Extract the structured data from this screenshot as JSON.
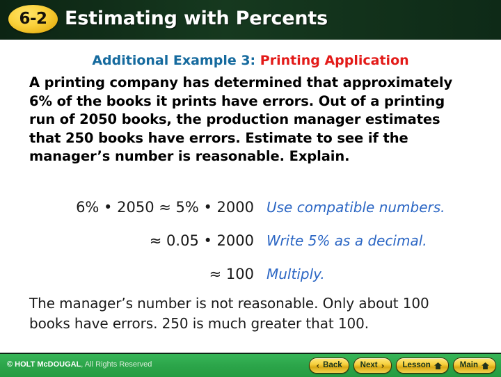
{
  "header": {
    "lesson_badge": "6-2",
    "title": "Estimating with Percents",
    "background_color": "#11321c",
    "badge_color": "#fbd23c"
  },
  "slide": {
    "example_heading": {
      "primary": "Additional Example 3:",
      "primary_color": "#156a9e",
      "secondary": "Printing Application",
      "secondary_color": "#e31a18"
    },
    "problem_text": "A printing company has determined that approximately 6% of the books it prints have errors. Out of a printing run of 2050 books, the production manager estimates that 250 books have errors. Estimate to see if the manager’s number is reasonable. Explain.",
    "steps": [
      {
        "math": "6% • 2050 ≈ 5% • 2000",
        "note": "Use compatible numbers."
      },
      {
        "math": "≈ 0.05 • 2000",
        "note": "Write 5% as a decimal."
      },
      {
        "math": "≈ 100",
        "note": "Multiply."
      }
    ],
    "note_color": "#2b66c4",
    "conclusion": "The manager’s number is not reasonable. Only about 100 books have errors. 250 is much greater that 100."
  },
  "footer": {
    "copyright_strong": "© HOLT McDOUGAL",
    "copyright_rest": ", All Rights Reserved",
    "background_color": "#2fab4f",
    "buttons": [
      {
        "label": "Back",
        "icon": "chevron-left-icon",
        "glyph": "‹",
        "icon_side": "left"
      },
      {
        "label": "Next",
        "icon": "chevron-right-icon",
        "glyph": "›",
        "icon_side": "right"
      },
      {
        "label": "Lesson",
        "icon": "home-icon",
        "glyph": "",
        "icon_side": "right"
      },
      {
        "label": "Main",
        "icon": "home-icon",
        "glyph": "",
        "icon_side": "right"
      }
    ]
  }
}
